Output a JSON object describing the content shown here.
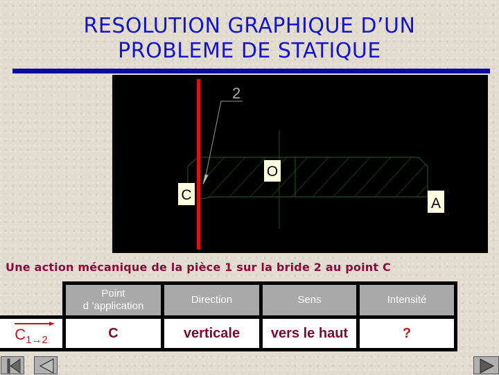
{
  "title": {
    "line1": "RESOLUTION GRAPHIQUE D’UN",
    "line2": "PROBLEME DE STATIQUE"
  },
  "drawing": {
    "part_label": "2",
    "points": {
      "O": "O",
      "C": "C",
      "A": "A"
    },
    "colors": {
      "action_line": "#e01010",
      "part_outline": "#1e4a1e",
      "label_bg": "#ffffe0"
    }
  },
  "caption": "Une action mécanique de la pièce 1 sur la bride 2 au point C",
  "table": {
    "headers": [
      "Point\nd ’application",
      "Direction",
      "Sens",
      "Intensité"
    ],
    "header_line1": "Point",
    "header_line2": "d ’application",
    "vector": {
      "letter": "C",
      "subscript": "1→2"
    },
    "values": [
      "C",
      "verticale",
      "vers le haut",
      "?"
    ]
  },
  "nav": {
    "first": "first-slide",
    "previous": "previous-slide",
    "next": "next-slide"
  }
}
